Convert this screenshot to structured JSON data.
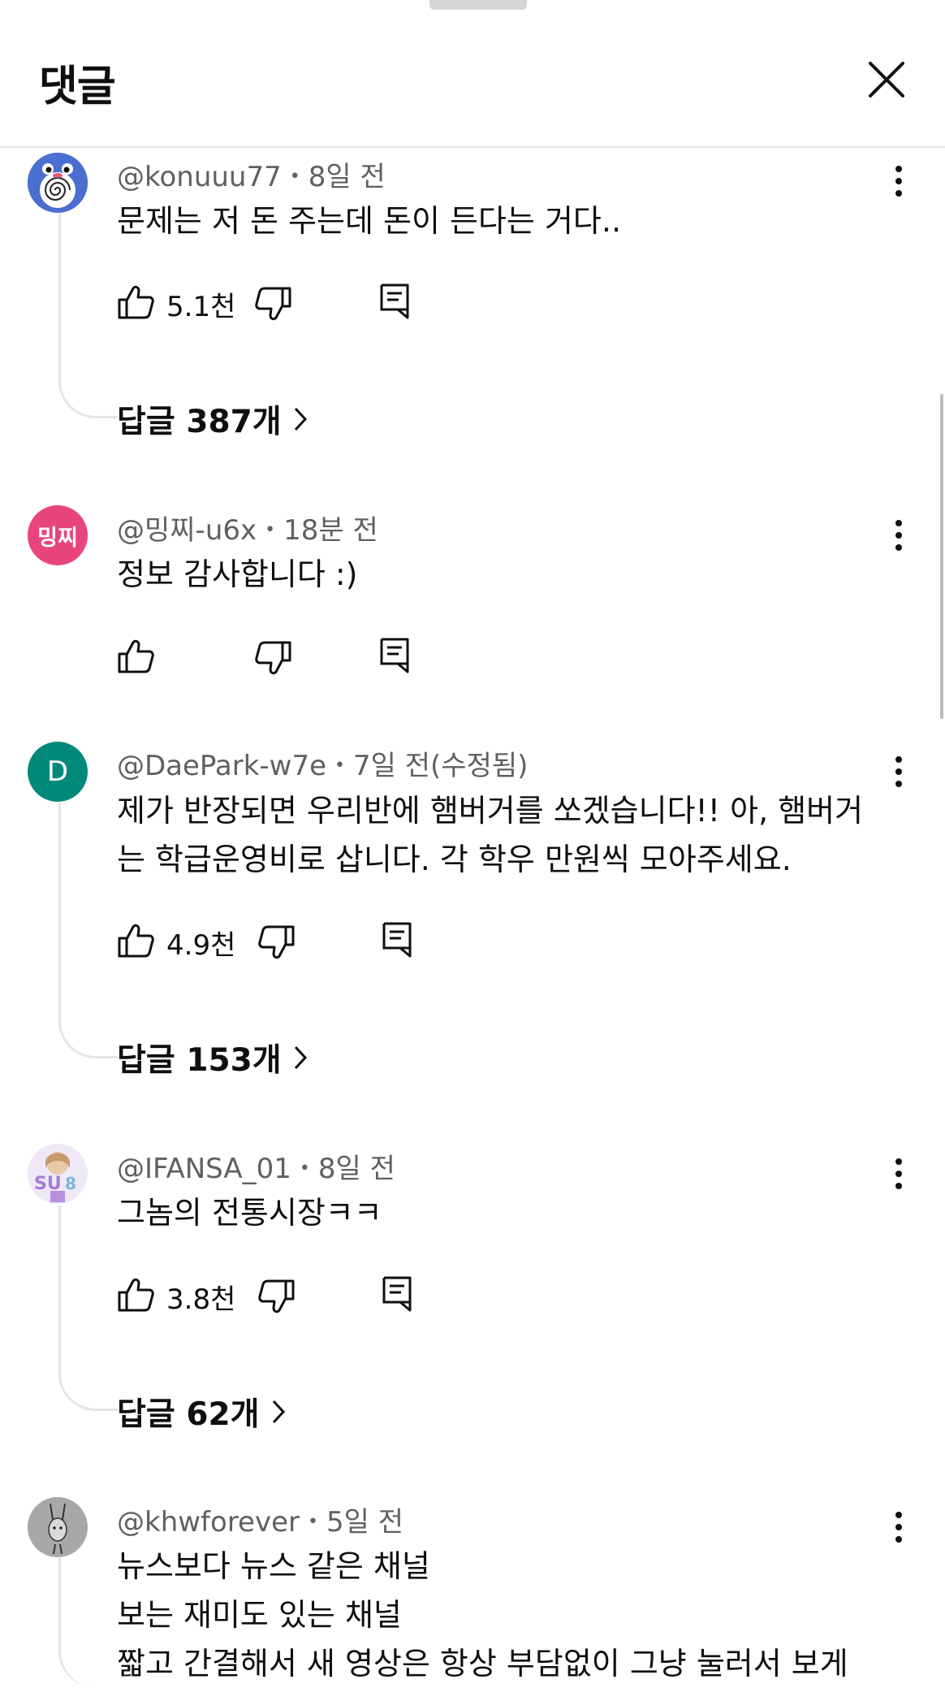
{
  "header": {
    "title": "댓글",
    "close_icon": "close-icon"
  },
  "comments": [
    {
      "author": "@konuuu77",
      "time": "8일 전",
      "lines": [
        "문제는 저 돈 주는데 돈이 든다는 거다.."
      ],
      "likes": "5.1천",
      "replies": "답글 387개"
    },
    {
      "author": "@밍찌-u6x",
      "time": "18분 전",
      "avatar_text": "밍찌",
      "lines": [
        "정보 감사합니다 :)"
      ]
    },
    {
      "author": "@DaePark-w7e",
      "time": "7일 전(수정됨)",
      "avatar_text": "D",
      "lines": [
        "제가 반장되면 우리반에 햄버거를 쏘겠습니다!! 아, 햄버거",
        "는 학급운영비로 삽니다. 각 학우 만원씩 모아주세요."
      ],
      "likes": "4.9천",
      "replies": "답글 153개"
    },
    {
      "author": "@IFANSA_01",
      "time": "8일 전",
      "lines": [
        "그놈의 전통시장ㅋㅋ"
      ],
      "likes": "3.8천",
      "replies": "답글 62개"
    },
    {
      "author": "@khwforever",
      "time": "5일 전",
      "lines": [
        "뉴스보다 뉴스 같은 채널",
        "보는 재미도 있는 채널",
        "짧고 간결해서 새 영상은 항상 부담없이 그냥 눌러서 보게"
      ]
    }
  ],
  "colors": {
    "avatar_pink": "#e8457a",
    "avatar_teal": "#00897b",
    "thread_line": "#e5e5e5",
    "meta_text": "#606060"
  }
}
